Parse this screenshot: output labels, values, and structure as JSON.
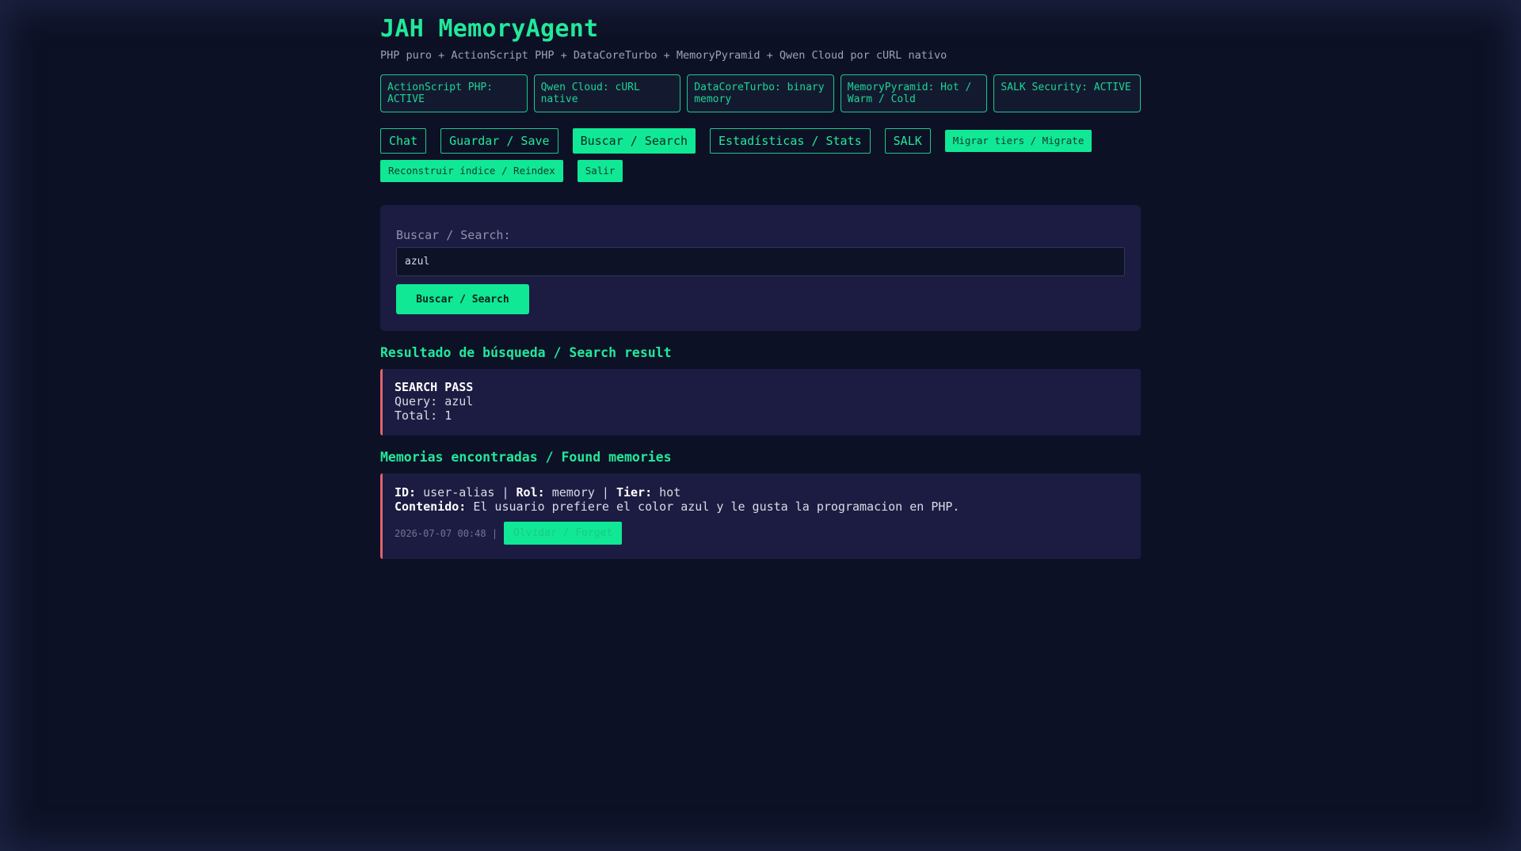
{
  "header": {
    "title": "JAH MemoryAgent",
    "subtitle": "PHP puro + ActionScript PHP + DataCoreTurbo + MemoryPyramid + Qwen Cloud por cURL nativo"
  },
  "status_cards": [
    "ActionScript PHP: ACTIVE",
    "Qwen Cloud: cURL native",
    "DataCoreTurbo: binary memory",
    "MemoryPyramid: Hot / Warm / Cold",
    "SALK Security: ACTIVE"
  ],
  "nav": {
    "chat": "Chat",
    "save": "Guardar / Save",
    "search": "Buscar / Search",
    "stats": "Estadísticas / Stats",
    "salk": "SALK",
    "migrate": "Migrar tiers / Migrate",
    "reindex": "Reconstruir índice / Reindex",
    "logout": "Salir"
  },
  "search": {
    "label": "Buscar / Search:",
    "value": "azul",
    "submit_label": "Buscar / Search"
  },
  "result": {
    "section_title": "Resultado de búsqueda / Search result",
    "status": "SEARCH PASS",
    "query_line": "Query: azul",
    "total_line": "Total: 1"
  },
  "memories": {
    "section_title": "Memorias encontradas / Found memories",
    "items": [
      {
        "id_label": "ID:",
        "id": "user-alias",
        "role_label": "Rol:",
        "role": "memory",
        "tier_label": "Tier:",
        "tier": "hot",
        "separator": "|",
        "content_label": "Contenido:",
        "content": "El usuario prefiere el color azul y le gusta la programacion en PHP.",
        "timestamp": "2026-07-07 00:48 |",
        "forget_label": "Olvidar / Forget"
      }
    ]
  },
  "colors": {
    "background": "#0d1125",
    "accent": "#10e895",
    "panel": "#1c1c42",
    "alert_border": "#e2646e"
  }
}
